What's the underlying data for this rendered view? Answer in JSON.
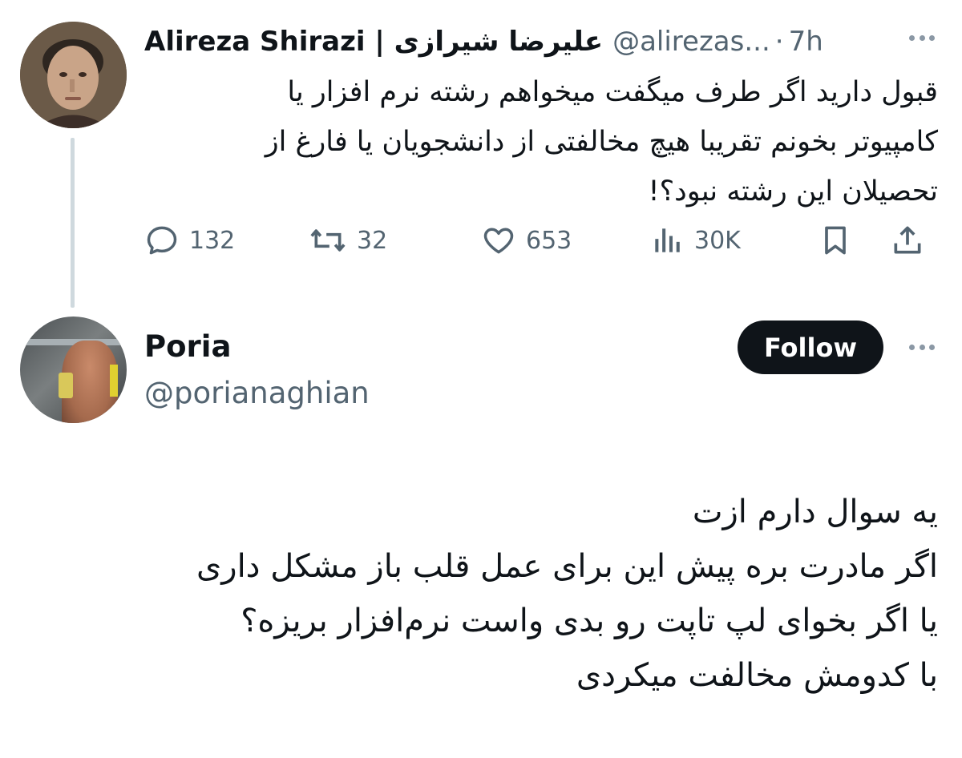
{
  "colors": {
    "text": "#0f1419",
    "secondary": "#536471",
    "thread_line": "#cfd9de",
    "follow_bg": "#0f1419",
    "follow_text": "#ffffff"
  },
  "original_tweet": {
    "avatar_icon": "profile-photo",
    "name": "Alireza Shirazi | علیرضا شیرازی",
    "handle": "@alirezas...",
    "separator": "·",
    "time": "7h",
    "more_icon": "more-horizontal-icon",
    "text_lines": [
      "قبول دارید اگر طرف میگفت میخواهم رشته نرم افزار یا",
      "کامپیوتر بخونم تقریبا هیچ مخالفتی از دانشجویان یا فارغ از",
      "تحصیلان این رشته نبود؟!"
    ],
    "actions": {
      "replies": "132",
      "retweets": "32",
      "likes": "653",
      "views": "30K"
    }
  },
  "reply_tweet": {
    "avatar_icon": "profile-photo",
    "name": "Poria",
    "handle": "@porianaghian",
    "follow_label": "Follow",
    "more_icon": "more-horizontal-icon",
    "text_lines": [
      "یه سوال دارم ازت",
      "اگر مادرت بره پیش این برای عمل قلب باز مشکل داری",
      "یا اگر بخوای لپ تاپت رو بدی واست نرم‌افزار بریزه؟",
      "با کدومش مخالفت میکردی"
    ]
  }
}
